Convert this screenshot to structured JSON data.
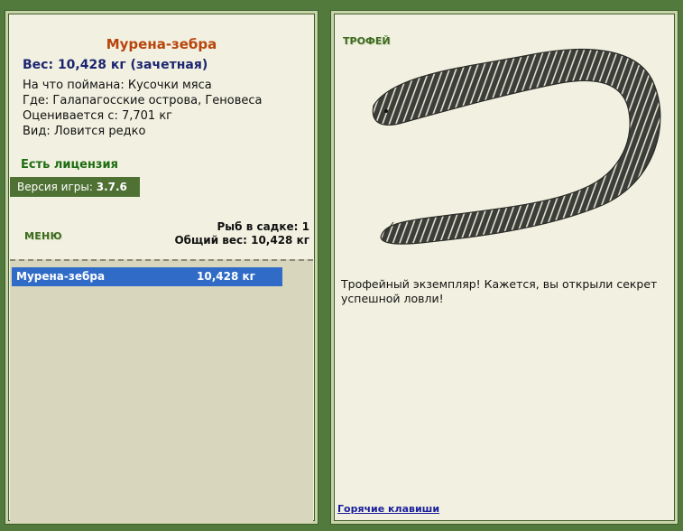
{
  "fish": {
    "name": "Мурена-зебра",
    "weight_line": "Вес: 10,428 кг (зачетная)",
    "bait_line": "На что поймана: Кусочки мяса",
    "location_line": "Где: Галапагосские острова, Геновеса",
    "value_line": "Оценивается с: 7,701 кг",
    "rarity_line": "Вид: Ловится редко"
  },
  "license": "Есть лицензия",
  "version": {
    "label": "Версия игры:",
    "value": "3.7.6"
  },
  "menu_label": "МЕНЮ",
  "keepnet": {
    "count_line": "Рыб в садке: 1",
    "total_line": "Общий вес: 10,428 кг"
  },
  "catch_list": [
    {
      "name": "Мурена-зебра",
      "weight": "10,428 кг"
    }
  ],
  "trophy": {
    "label": "ТРОФЕЙ",
    "text": "Трофейный экземпляр! Кажется, вы открыли секрет успешной ловли!",
    "image_icon": "zebra-moray-eel-image"
  },
  "hotkeys_link": "Горячие клавиши",
  "colors": {
    "background": "#527a3d",
    "panel": "#f2f1e1",
    "fish_title": "#b8440a",
    "weight": "#1c2570",
    "license": "#1f6d12",
    "selected_row": "#2f6bc7",
    "link": "#1c1f9c"
  }
}
